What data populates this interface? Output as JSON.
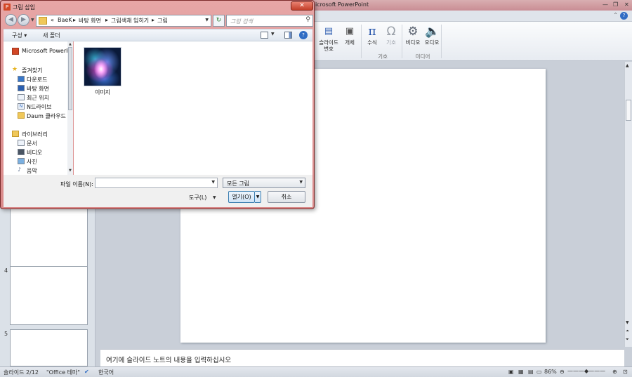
{
  "ppt": {
    "title": "icrosoft PowerPoint",
    "ribbon": {
      "slide_number_label": "슬라이드 번호",
      "object_label": "개체",
      "equation_label": "수식",
      "symbol_label": "기호",
      "video_label": "비디오",
      "audio_label": "오디오",
      "group_symbols": "기호",
      "group_media": "미디어"
    },
    "thumbnails": [
      "4",
      "5"
    ],
    "notes_placeholder": "여기에 슬라이드 노트의 내용을 입력하십시오",
    "status": {
      "slide": "슬라이드 2/12",
      "theme": "\"Office 테마\"",
      "language": "한국어",
      "zoom": "86%"
    }
  },
  "dialog": {
    "title": "그림 삽입",
    "breadcrumb": [
      "«",
      "BaeK",
      "바탕 화면",
      "그림색채 입히기",
      "그림"
    ],
    "search_placeholder": "그림 검색",
    "organize": "구성 ▾",
    "new_folder": "새 폴더",
    "nav": [
      "Microsoft PowerPo",
      "즐겨찾기",
      "다운로드",
      "바탕 화면",
      "최근 위치",
      "N드라이브",
      "Daum 클라우드",
      "라이브러리",
      "문서",
      "비디오",
      "사진",
      "음악"
    ],
    "file_label": "이미지",
    "filename_label": "파일 이름(N):",
    "filename_value": "",
    "filetype": "모든 그림",
    "tools": "도구(L)",
    "open": "열기(O)",
    "cancel": "취소"
  },
  "colors": {
    "dialog_frame": "#d98a8a",
    "close_button": "#c33f2b",
    "accent_blue": "#2f6cc4"
  }
}
